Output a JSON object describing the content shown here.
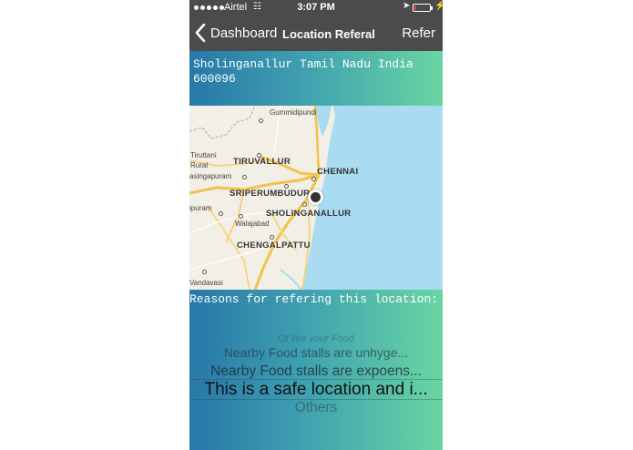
{
  "status_bar": {
    "carrier": "Airtel",
    "time": "3:07 PM",
    "battery_level": 0.15
  },
  "nav": {
    "back_label": "Dashboard",
    "title": "Location Referal",
    "right_button": "Refer"
  },
  "address": "Sholinganallur Tamil Nadu India 600096",
  "map": {
    "labels": {
      "gummidipundi": "Gummidipundi",
      "chennai": "CHENNAI",
      "tiruvallur": "TIRUVALLUR",
      "tiruttani": "Tiruttani",
      "rural": "Rural",
      "asingapuram": "asingapuram",
      "sriperumbudur": "SRIPERUMBUDUR",
      "sholinganallur": "SHOLINGANALLUR",
      "ipuram": "ipuram",
      "walajabad": "Walajabad",
      "chengalpattu": "CHENGALPATTU",
      "vandavasi": "Vandavasi"
    }
  },
  "reasons": {
    "label": "Reasons for refering this location:",
    "options": [
      "Of like your Food",
      "Nearby Food stalls are unhyge...",
      "Nearby Food stalls are expoens...",
      "This is a safe location and i...",
      "Others"
    ]
  },
  "colors": {
    "nav_bg": "#4b4b4b",
    "gradient_start": "#2778a8",
    "gradient_end": "#6ad6a2",
    "sea": "#a9dcf0"
  }
}
